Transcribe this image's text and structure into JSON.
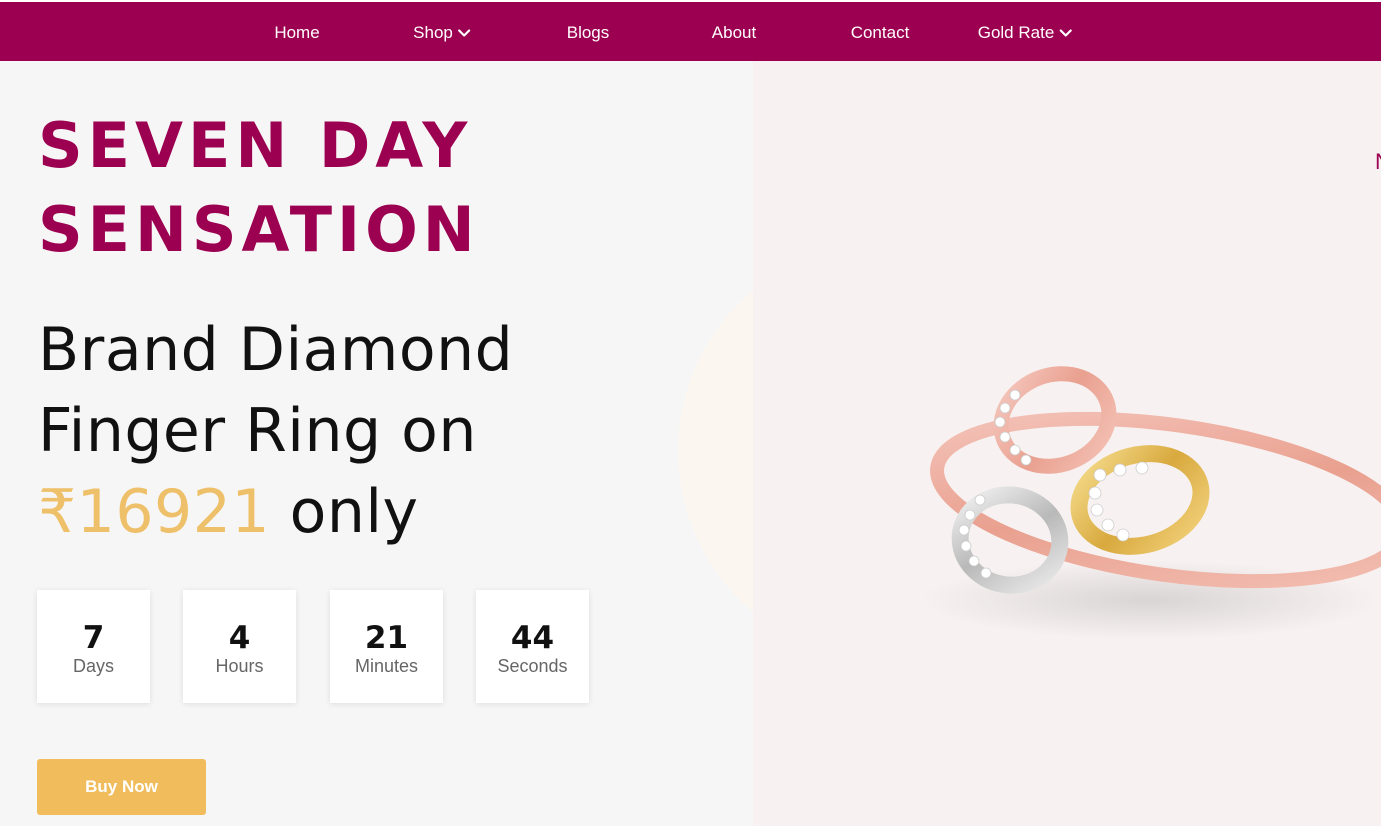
{
  "nav": {
    "items": [
      {
        "label": "Home",
        "has_dropdown": false
      },
      {
        "label": "Shop",
        "has_dropdown": true
      },
      {
        "label": "Blogs",
        "has_dropdown": false
      },
      {
        "label": "About",
        "has_dropdown": false
      },
      {
        "label": "Contact",
        "has_dropdown": false
      },
      {
        "label": "Gold Rate",
        "has_dropdown": true
      }
    ],
    "dropdown_icon": "chevron-down-icon"
  },
  "hero": {
    "headline": "SEVEN DAY\nSENSATION",
    "offer_prefix": "Brand Diamond Finger Ring on ",
    "price": "₹16921",
    "offer_suffix": " only",
    "image": "diamond-ring-image"
  },
  "countdown": [
    {
      "value": "7",
      "unit": "Days"
    },
    {
      "value": "4",
      "unit": "Hours"
    },
    {
      "value": "21",
      "unit": "Minutes"
    },
    {
      "value": "44",
      "unit": "Seconds"
    }
  ],
  "cta": {
    "label": "Buy Now"
  },
  "colors": {
    "brand": "#9c0050",
    "accent": "#eec06a",
    "button": "#f0bc5c",
    "text": "#111111"
  }
}
